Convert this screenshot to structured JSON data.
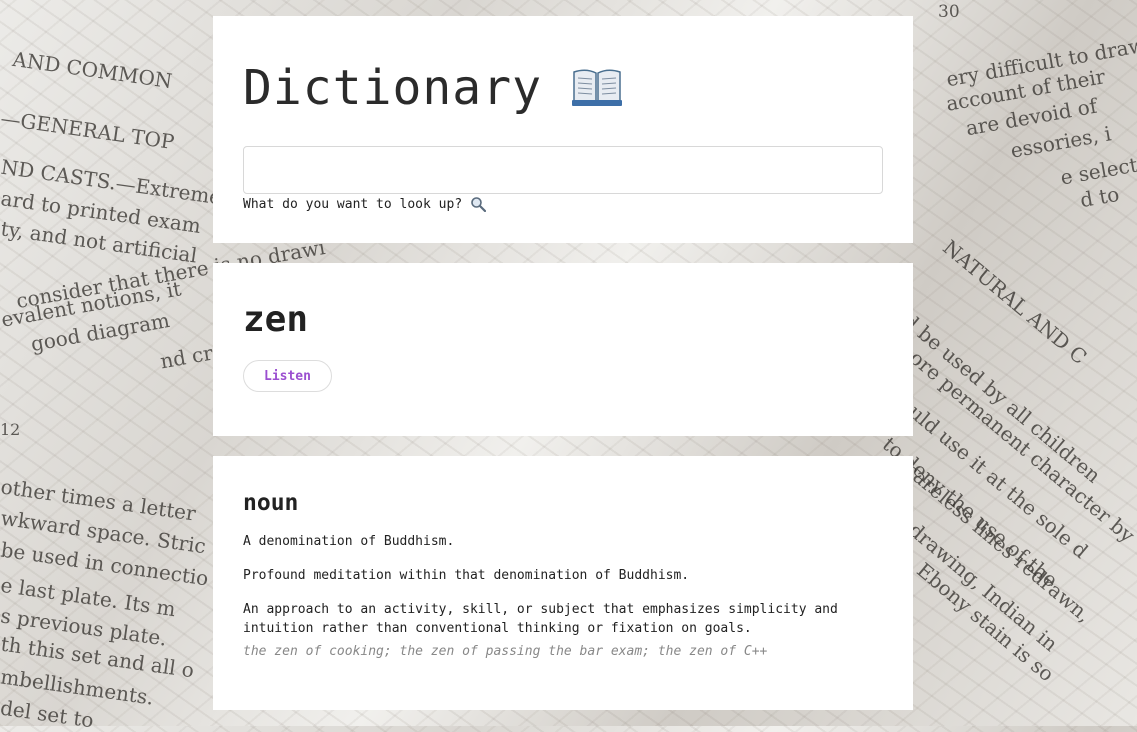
{
  "header": {
    "title": "Dictionary",
    "icon": "open-book-icon",
    "search": {
      "value": "",
      "placeholder": "",
      "label": "What do you want to look up?",
      "icon": "magnifying-glass-icon"
    }
  },
  "word": {
    "text": "zen",
    "listen_label": "Listen"
  },
  "meaning": {
    "part_of_speech": "noun",
    "definitions": [
      "A denomination of Buddhism.",
      "Profound meditation within that denomination of Buddhism.",
      "An approach to an activity, skill, or subject that emphasizes simplicity and intuition rather than conventional thinking or fixation on goals."
    ],
    "example": "the zen of cooking; the zen of passing the bar exam; the zen of C++"
  },
  "background_text": [
    "AND COMMON",
    "—GENERAL TOP",
    "ND CASTS.—Extreme",
    "ard to printed exam",
    "ty, and not artificial",
    "consider that there is no drawi",
    "evalent notions, it",
    "good diagram",
    "nd cr",
    "30",
    "ery difficult to draw",
    "account of their",
    "are devoid of",
    "essories, i",
    "e selecte",
    "d to",
    "NATURAL AND C",
    "uld be used by all children",
    "of more permanent character by",
    "would use it at the sole d",
    "to deny the use of the",
    "careless lines redrawn,",
    "drawing, Indian in",
    "Ebony stain is so",
    "12",
    "other times a letter",
    "wkward space. Stric",
    "be used in connectio",
    "e last plate. Its m",
    "s previous plate.",
    "th this set and all o",
    "mbellishments.",
    "del set to"
  ],
  "colors": {
    "accent": "#9b4fd0",
    "card": "#ffffff",
    "text": "#222222",
    "example": "#888888"
  }
}
